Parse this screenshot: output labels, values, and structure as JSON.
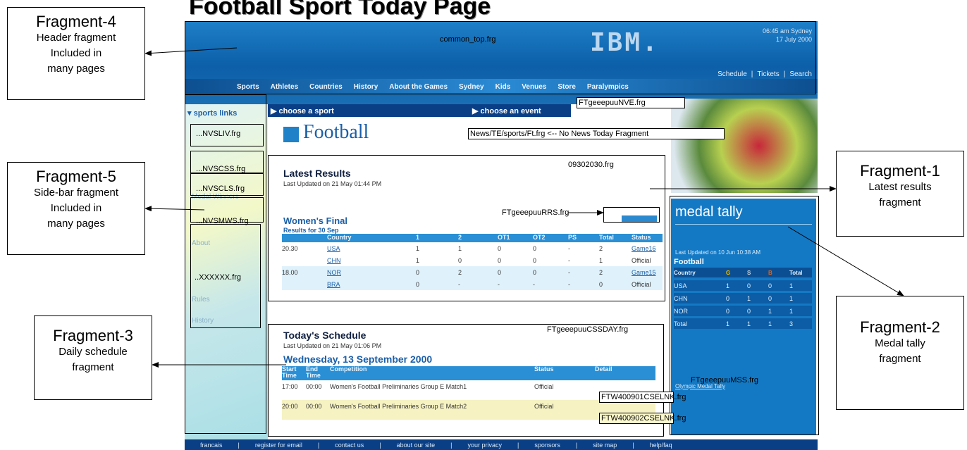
{
  "title": "Football Sport Today Page",
  "callouts": [
    {
      "title": "Fragment-4",
      "desc": [
        "Header fragment",
        "Included in",
        "many pages"
      ]
    },
    {
      "title": "Fragment-5",
      "desc": [
        "Side-bar fragment",
        "Included in",
        "many pages"
      ]
    },
    {
      "title": "Fragment-3",
      "desc": [
        "Daily schedule",
        "fragment"
      ]
    },
    {
      "title": "Fragment-1",
      "desc": [
        "Latest results",
        "fragment"
      ]
    },
    {
      "title": "Fragment-2",
      "desc": [
        "Medal tally",
        "fragment"
      ]
    }
  ],
  "fragment_labels": {
    "header": "common_top.frg",
    "nav": "FTgeeepuuNVE.frg",
    "no_news": "News/TE/sports/Ft.frg  <-- No News Today Fragment",
    "latest": "09302030.frg",
    "results": "FTgeeepuuRRS.frg",
    "schedule": "FTgeeepuuCSSDAY.frg",
    "medal": "FTgeeepuuMSS.frg",
    "link1": "FTW400901CSELNK.frg",
    "link2": "FTW400902CSELNK.frg",
    "side_1": "...NVSLIV.frg",
    "side_2": "...NVSCSS.frg",
    "side_3": "...NVSCLS.frg",
    "side_4": "...NVSMWS.frg",
    "side_5": "..XXXXXX.frg"
  },
  "page": {
    "logo": "IBM.",
    "datetime": [
      "06:45 am Sydney",
      "17 July 2000"
    ],
    "utility_links": [
      "Schedule",
      "|",
      "Tickets",
      "|",
      "Search"
    ],
    "nav": [
      "Sports",
      "Athletes",
      "Countries",
      "History",
      "About the Games",
      "Sydney",
      "Kids",
      "Venues",
      "Store",
      "Paralympics"
    ],
    "sidebar_heading": "▾ sports links",
    "sidebar_items": [
      "Medal Winners",
      "About",
      "Rules",
      "History"
    ],
    "choose_sport": "▶ choose a sport",
    "choose_event": "▶ choose an event",
    "sport_title": "Football",
    "latest_results": {
      "title": "Latest Results",
      "updated": "Last Updated on 21 May 01:44 PM",
      "event": "Women's Final",
      "results_for": "Results for 30 Sep",
      "headers": [
        "",
        "Country",
        "1",
        "2",
        "OT1",
        "OT2",
        "PS",
        "Total",
        "Status"
      ],
      "rows": [
        [
          "20.30",
          "USA",
          "1",
          "1",
          "0",
          "0",
          "-",
          "2",
          "Game16"
        ],
        [
          "",
          "CHN",
          "1",
          "0",
          "0",
          "0",
          "-",
          "1",
          "Official"
        ],
        [
          "18.00",
          "NOR",
          "0",
          "2",
          "0",
          "0",
          "-",
          "2",
          "Game15"
        ],
        [
          "",
          "BRA",
          "0",
          "-",
          "-",
          "-",
          "-",
          "0",
          "Official"
        ]
      ]
    },
    "schedule": {
      "title": "Today's Schedule",
      "updated": "Last Updated on 21 May 01:06 PM",
      "date": "Wednesday, 13 September 2000",
      "headers": [
        "Start Time",
        "End Time",
        "Competition",
        "Status",
        "Detail"
      ],
      "rows": [
        [
          "17:00",
          "00:00",
          "Women's Football Preliminaries Group E Match1",
          "Official",
          ""
        ],
        [
          "20:00",
          "00:00",
          "Women's Football Preliminaries Group E Match2",
          "Official",
          ""
        ]
      ]
    },
    "medal_tally": {
      "title": "medal tally",
      "updated": "Last Updated on 10 Jun 10:38 AM",
      "sport": "Football",
      "headers": [
        "Country",
        "G",
        "S",
        "B",
        "Total"
      ],
      "rows": [
        [
          "USA",
          "1",
          "0",
          "0",
          "1"
        ],
        [
          "CHN",
          "0",
          "1",
          "0",
          "1"
        ],
        [
          "NOR",
          "0",
          "0",
          "1",
          "1"
        ],
        [
          "Total",
          "1",
          "1",
          "1",
          "3"
        ]
      ],
      "link": "Olympic Medal Tally"
    },
    "footer_links": [
      "francais",
      "|",
      "register for email",
      "|",
      "contact us",
      "|",
      "about our site",
      "|",
      "your privacy",
      "|",
      "sponsors",
      "|",
      "site map",
      "|",
      "help/faq"
    ]
  }
}
